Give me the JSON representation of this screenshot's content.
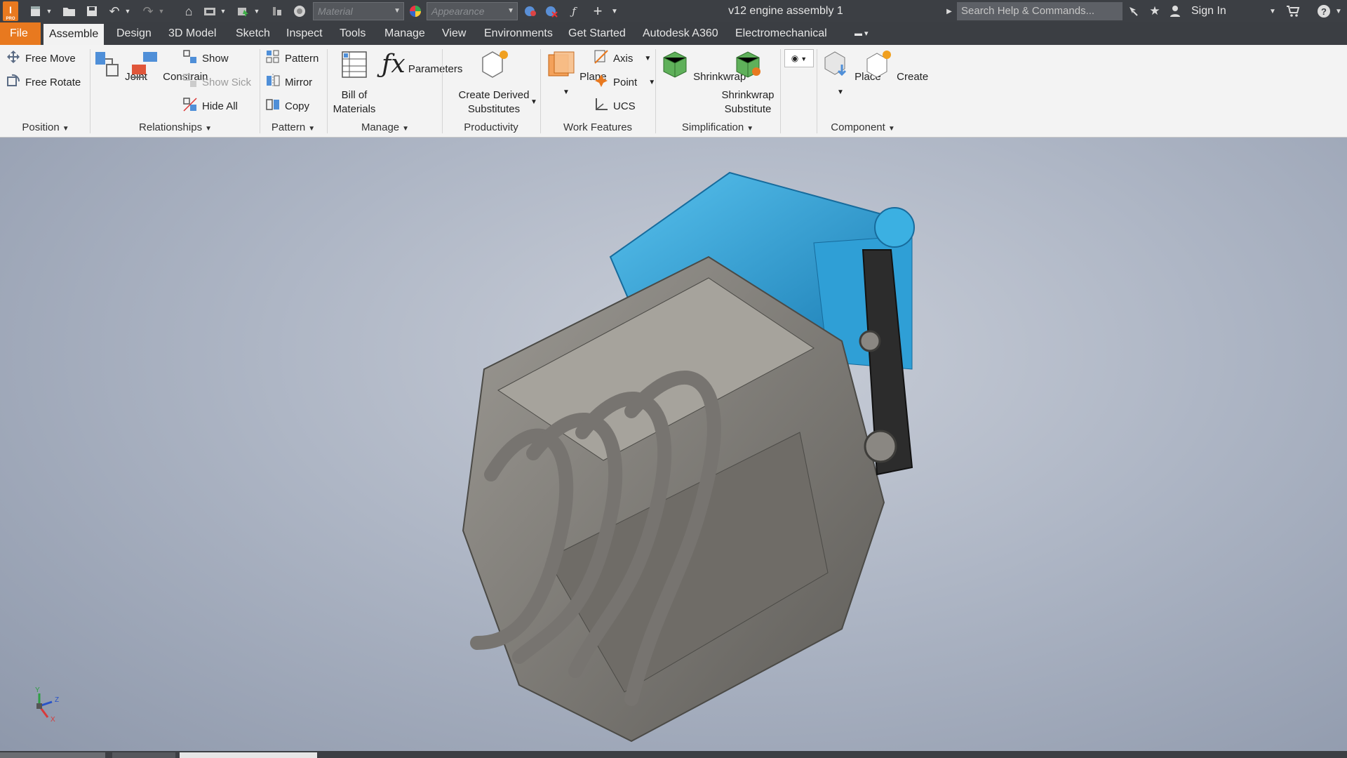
{
  "titlebar": {
    "app_logo": "I",
    "app_logo_sub": "PRO",
    "material_placeholder": "Material",
    "appearance_placeholder": "Appearance",
    "doc_title": "v12 engine assembly 1",
    "search_placeholder": "Search Help & Commands...",
    "signin": "Sign In"
  },
  "menu": {
    "file": "File",
    "tabs": [
      "Assemble",
      "Design",
      "3D Model",
      "Sketch",
      "Inspect",
      "Tools",
      "Manage",
      "View",
      "Environments",
      "Get Started",
      "Autodesk A360",
      "Electromechanical"
    ]
  },
  "ribbon": {
    "position": {
      "free_move": "Free Move",
      "free_rotate": "Free Rotate",
      "label": "Position"
    },
    "relationships": {
      "joint": "Joint",
      "constrain": "Constrain",
      "show": "Show",
      "show_sick": "Show Sick",
      "hide_all": "Hide All",
      "label": "Relationships"
    },
    "pattern": {
      "pattern": "Pattern",
      "mirror": "Mirror",
      "copy": "Copy",
      "label": "Pattern"
    },
    "manage": {
      "bom_1": "Bill of",
      "bom_2": "Materials",
      "parameters": "Parameters",
      "label": "Manage"
    },
    "productivity": {
      "cds_1": "Create Derived",
      "cds_2": "Substitutes",
      "label": "Productivity"
    },
    "work_features": {
      "plane": "Plane",
      "axis": "Axis",
      "point": "Point",
      "ucs": "UCS",
      "label": "Work Features"
    },
    "simplification": {
      "shrinkwrap": "Shrinkwrap",
      "sws_1": "Shrinkwrap",
      "sws_2": "Substitute",
      "label": "Simplification"
    },
    "component": {
      "place": "Place",
      "create": "Create",
      "label": "Component"
    }
  },
  "viewport": {
    "triad": {
      "x": "X",
      "y": "Y",
      "z": "Z"
    }
  },
  "colors": {
    "accent": "#e8791f",
    "intake": "#35a9dc",
    "engine": "#7c7a75",
    "belt": "#2c2c2c"
  }
}
